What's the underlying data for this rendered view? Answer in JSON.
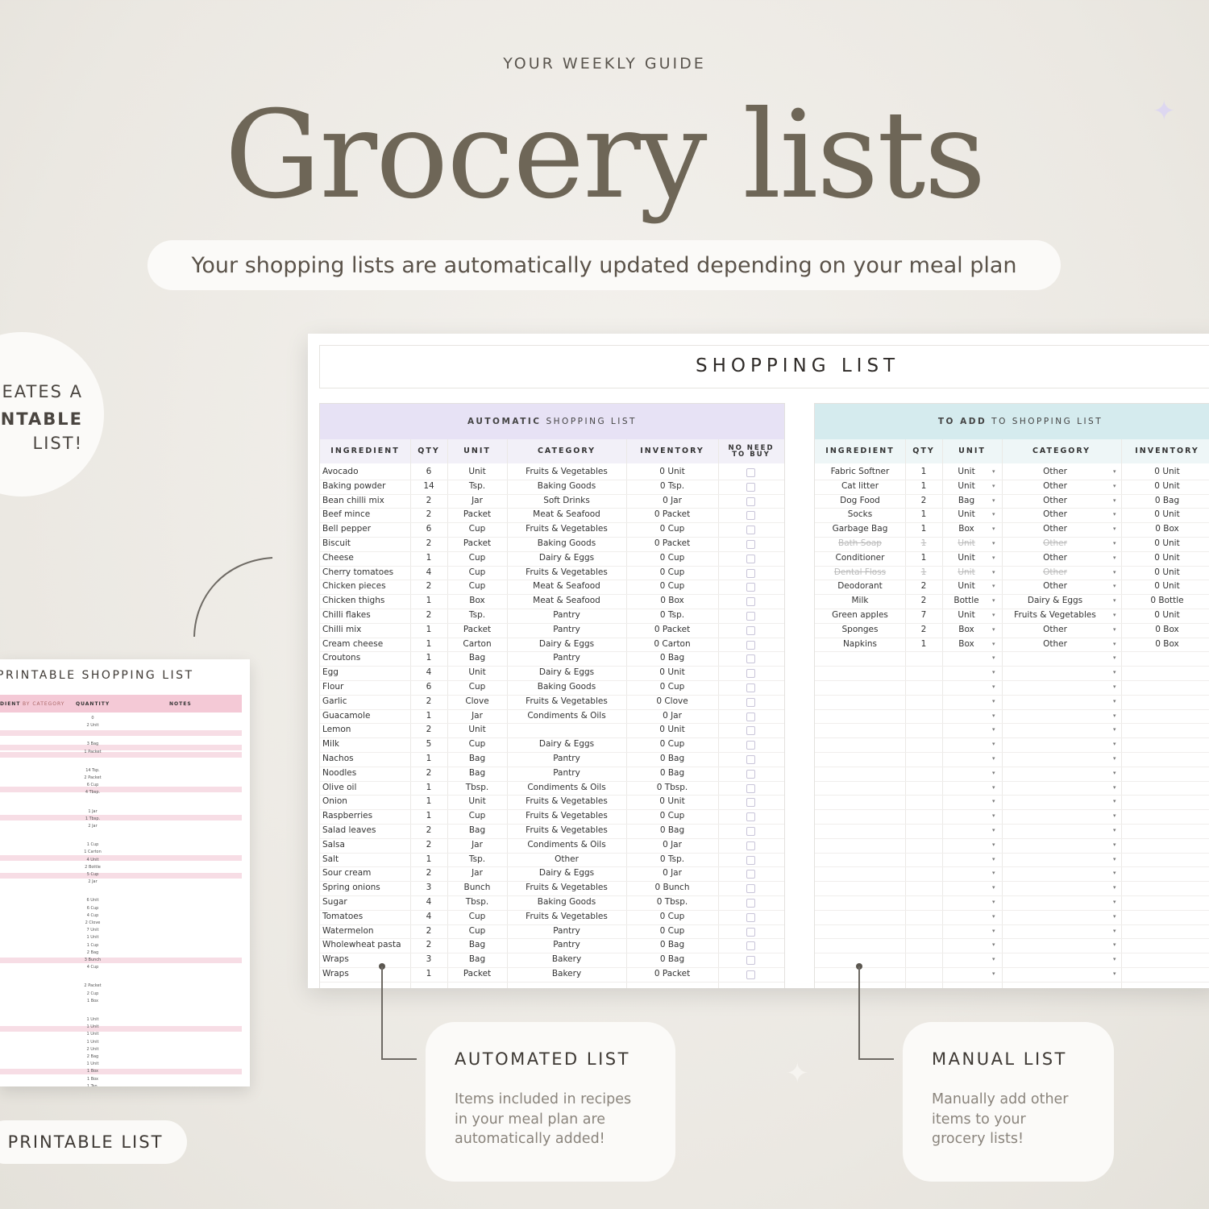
{
  "header": {
    "kicker": "YOUR WEEKLY GUIDE",
    "title": "Grocery lists",
    "subtitle": "Your shopping lists are automatically updated depending on your meal plan"
  },
  "badge": {
    "lines": [
      "EATES A",
      "NTABLE",
      "LIST!"
    ]
  },
  "printable": {
    "title": "PRINTABLE SHOPPING LIST",
    "col_ingredient": "DIENT",
    "col_ingredient_suffix": "BY CATEGORY",
    "col_quantity": "QUANTITY",
    "col_notes": "NOTES",
    "values": [
      "0",
      "2 Unit",
      "3 Bag",
      "1 Packet",
      "14 Tsp.",
      "2 Packet",
      "6 Cup",
      "4 Tbsp.",
      "1 Jar",
      "1 Tbsp.",
      "2 Jar",
      "1 Cup",
      "1 Carton",
      "4 Unit",
      "2 Bottle",
      "5 Cup",
      "2 Jar",
      "6 Unit",
      "6 Cup",
      "4 Cup",
      "2 Clove",
      "7 Unit",
      "1 Unit",
      "1 Cup",
      "2 Bag",
      "3 Bunch",
      "4 Cup",
      "2 Packet",
      "2 Cup",
      "1 Box",
      "1 Unit",
      "1 Unit",
      "1 Unit",
      "1 Unit",
      "2 Unit",
      "2 Bag",
      "1 Unit",
      "1 Box",
      "1 Box",
      "1 Tsp.",
      "1 Unit",
      "2 Box"
    ],
    "pill_label": "PRINTABLE LIST"
  },
  "sheet": {
    "title": "SHOPPING LIST",
    "auto": {
      "heading_bold": "AUTOMATIC",
      "heading_rest": "SHOPPING LIST",
      "columns": [
        "INGREDIENT",
        "QTY",
        "UNIT",
        "CATEGORY",
        "INVENTORY",
        "NO NEED TO BUY"
      ],
      "rows": [
        [
          "Avocado",
          "6",
          "Unit",
          "Fruits & Vegetables",
          "0 Unit"
        ],
        [
          "Baking powder",
          "14",
          "Tsp.",
          "Baking Goods",
          "0 Tsp."
        ],
        [
          "Bean chilli mix",
          "2",
          "Jar",
          "Soft Drinks",
          "0 Jar"
        ],
        [
          "Beef mince",
          "2",
          "Packet",
          "Meat & Seafood",
          "0 Packet"
        ],
        [
          "Bell pepper",
          "6",
          "Cup",
          "Fruits & Vegetables",
          "0 Cup"
        ],
        [
          "Biscuit",
          "2",
          "Packet",
          "Baking Goods",
          "0 Packet"
        ],
        [
          "Cheese",
          "1",
          "Cup",
          "Dairy & Eggs",
          "0 Cup"
        ],
        [
          "Cherry tomatoes",
          "4",
          "Cup",
          "Fruits & Vegetables",
          "0 Cup"
        ],
        [
          "Chicken pieces",
          "2",
          "Cup",
          "Meat & Seafood",
          "0 Cup"
        ],
        [
          "Chicken thighs",
          "1",
          "Box",
          "Meat & Seafood",
          "0 Box"
        ],
        [
          "Chilli flakes",
          "2",
          "Tsp.",
          "Pantry",
          "0 Tsp."
        ],
        [
          "Chilli mix",
          "1",
          "Packet",
          "Pantry",
          "0 Packet"
        ],
        [
          "Cream cheese",
          "1",
          "Carton",
          "Dairy & Eggs",
          "0 Carton"
        ],
        [
          "Croutons",
          "1",
          "Bag",
          "Pantry",
          "0 Bag"
        ],
        [
          "Egg",
          "4",
          "Unit",
          "Dairy & Eggs",
          "0 Unit"
        ],
        [
          "Flour",
          "6",
          "Cup",
          "Baking Goods",
          "0 Cup"
        ],
        [
          "Garlic",
          "2",
          "Clove",
          "Fruits & Vegetables",
          "0 Clove"
        ],
        [
          "Guacamole",
          "1",
          "Jar",
          "Condiments & Oils",
          "0 Jar"
        ],
        [
          "Lemon",
          "2",
          "Unit",
          "",
          "0 Unit"
        ],
        [
          "Milk",
          "5",
          "Cup",
          "Dairy & Eggs",
          "0 Cup"
        ],
        [
          "Nachos",
          "1",
          "Bag",
          "Pantry",
          "0 Bag"
        ],
        [
          "Noodles",
          "2",
          "Bag",
          "Pantry",
          "0 Bag"
        ],
        [
          "Olive oil",
          "1",
          "Tbsp.",
          "Condiments & Oils",
          "0 Tbsp."
        ],
        [
          "Onion",
          "1",
          "Unit",
          "Fruits & Vegetables",
          "0 Unit"
        ],
        [
          "Raspberries",
          "1",
          "Cup",
          "Fruits & Vegetables",
          "0 Cup"
        ],
        [
          "Salad leaves",
          "2",
          "Bag",
          "Fruits & Vegetables",
          "0 Bag"
        ],
        [
          "Salsa",
          "2",
          "Jar",
          "Condiments & Oils",
          "0 Jar"
        ],
        [
          "Salt",
          "1",
          "Tsp.",
          "Other",
          "0 Tsp."
        ],
        [
          "Sour cream",
          "2",
          "Jar",
          "Dairy & Eggs",
          "0 Jar"
        ],
        [
          "Spring onions",
          "3",
          "Bunch",
          "Fruits & Vegetables",
          "0 Bunch"
        ],
        [
          "Sugar",
          "4",
          "Tbsp.",
          "Baking Goods",
          "0 Tbsp."
        ],
        [
          "Tomatoes",
          "4",
          "Cup",
          "Fruits & Vegetables",
          "0 Cup"
        ],
        [
          "Watermelon",
          "2",
          "Cup",
          "Pantry",
          "0 Cup"
        ],
        [
          "Wholewheat pasta",
          "2",
          "Bag",
          "Pantry",
          "0 Bag"
        ],
        [
          "Wraps",
          "3",
          "Bag",
          "Bakery",
          "0 Bag"
        ],
        [
          "Wraps",
          "1",
          "Packet",
          "Bakery",
          "0 Packet"
        ]
      ]
    },
    "manual": {
      "heading_bold": "TO ADD",
      "heading_rest": "TO SHOPPING LIST",
      "columns": [
        "INGREDIENT",
        "QTY",
        "UNIT",
        "CATEGORY",
        "INVENTORY"
      ],
      "rows": [
        [
          "Fabric Softner",
          "1",
          "Unit",
          "Other",
          "0 Unit",
          false
        ],
        [
          "Cat litter",
          "1",
          "Unit",
          "Other",
          "0 Unit",
          false
        ],
        [
          "Dog Food",
          "2",
          "Bag",
          "Other",
          "0 Bag",
          false
        ],
        [
          "Socks",
          "1",
          "Unit",
          "Other",
          "0 Unit",
          false
        ],
        [
          "Garbage Bag",
          "1",
          "Box",
          "Other",
          "0 Box",
          false
        ],
        [
          "Bath Soap",
          "1",
          "Unit",
          "Other",
          "0 Unit",
          true
        ],
        [
          "Conditioner",
          "1",
          "Unit",
          "Other",
          "0 Unit",
          false
        ],
        [
          "Dental Floss",
          "1",
          "Unit",
          "Other",
          "0 Unit",
          true
        ],
        [
          "Deodorant",
          "2",
          "Unit",
          "Other",
          "0 Unit",
          false
        ],
        [
          "Milk",
          "2",
          "Bottle",
          "Dairy & Eggs",
          "0 Bottle",
          false
        ],
        [
          "Green apples",
          "7",
          "Unit",
          "Fruits & Vegetables",
          "0 Unit",
          false
        ],
        [
          "Sponges",
          "2",
          "Box",
          "Other",
          "0 Box",
          false
        ],
        [
          "Napkins",
          "1",
          "Box",
          "Other",
          "0 Box",
          false
        ]
      ],
      "empty_rows": 23
    }
  },
  "callouts": {
    "auto": {
      "title": "AUTOMATED LIST",
      "text": "Items included in recipes\nin your meal plan are\nautomatically added!"
    },
    "manual": {
      "title": "MANUAL LIST",
      "text": "Manually add other\nitems to your\ngrocery lists!"
    }
  },
  "colors": {
    "auto_header": "#e7e2f5",
    "manual_header": "#d5ebee",
    "printable_header": "#f4c9d6",
    "title_color": "#6e6657"
  }
}
